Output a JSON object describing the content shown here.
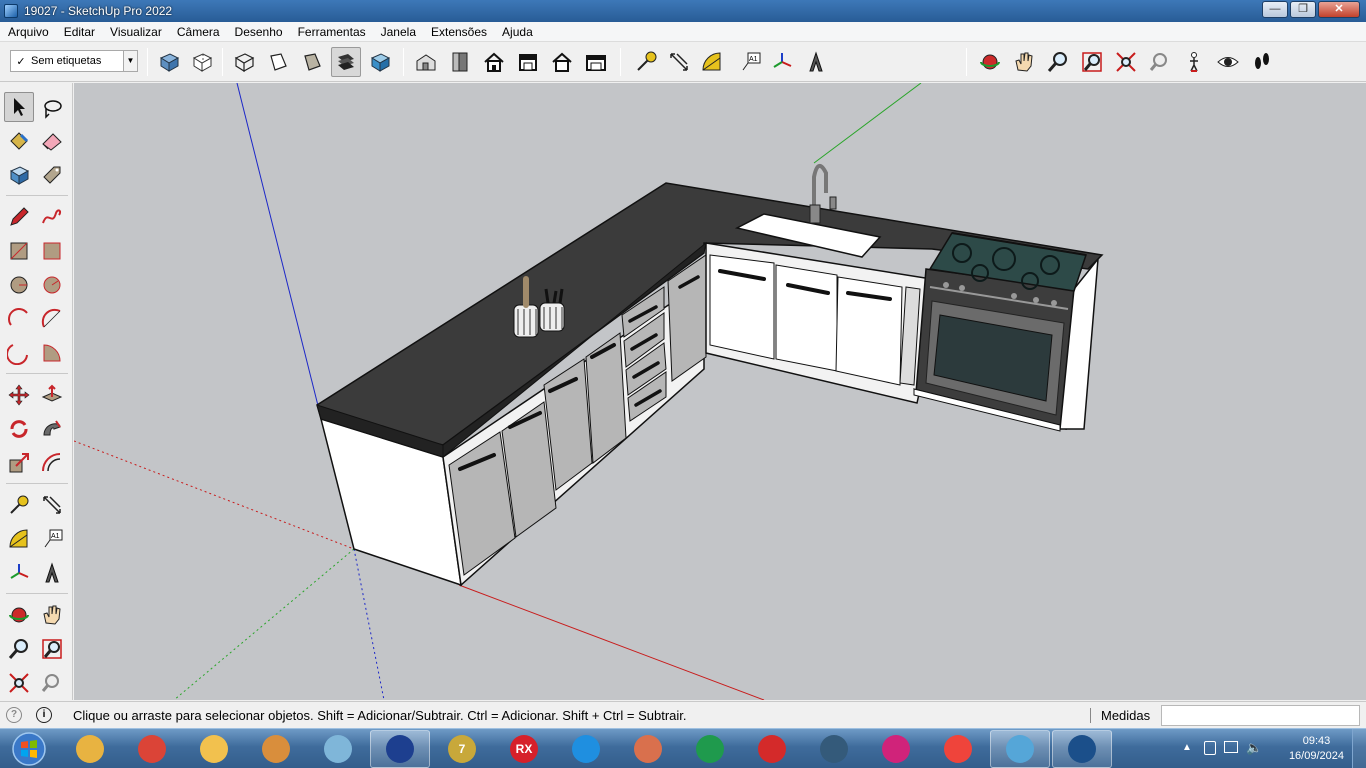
{
  "window": {
    "title": "19027 - SketchUp Pro 2022",
    "buttons": {
      "minimize": "—",
      "maximize": "❐",
      "close": "✕"
    }
  },
  "menu": [
    "Arquivo",
    "Editar",
    "Visualizar",
    "Câmera",
    "Desenho",
    "Ferramentas",
    "Janela",
    "Extensões",
    "Ajuda"
  ],
  "toolbar": {
    "tag_selector": {
      "value": "Sem etiquetas",
      "checked": true
    },
    "style_icons": [
      "xray-style-icon",
      "back-edges-style-icon",
      "wireframe-style-icon",
      "hidden-line-style-icon",
      "shaded-style-icon",
      "shaded-textures-style-icon",
      "monochrome-style-icon"
    ],
    "active_style": "shaded-textures-style-icon",
    "view_icons": [
      "iso-view-icon",
      "top-view-icon",
      "front-view-icon",
      "right-view-icon",
      "back-view-icon",
      "left-view-icon"
    ],
    "construction_icons": [
      "tape-measure-icon",
      "dimension-icon",
      "protractor-icon",
      "text-icon",
      "axes-icon",
      "3d-text-icon"
    ],
    "camera_icons": [
      "orbit-icon",
      "pan-icon",
      "zoom-icon",
      "zoom-window-icon",
      "zoom-extents-icon",
      "previous-view-icon",
      "position-camera-icon",
      "look-around-icon",
      "walk-icon"
    ]
  },
  "palette": {
    "active_tool": "select-tool-icon",
    "tools": [
      "select-tool-icon",
      "lasso-select-icon",
      "paint-bucket-icon",
      "eraser-icon",
      "make-component-icon",
      "tag-tool-icon",
      "pencil-icon",
      "freehand-icon",
      "rectangle-icon",
      "rotated-rectangle-icon",
      "circle-icon",
      "polygon-icon",
      "arc-icon",
      "two-point-arc-icon",
      "three-point-arc-icon",
      "pie-icon",
      "move-icon",
      "push-pull-icon",
      "rotate-icon",
      "follow-me-icon",
      "scale-icon",
      "offset-icon",
      "tape-measure-icon",
      "dimension-icon",
      "protractor-icon",
      "text-icon",
      "axes-icon",
      "3d-text-icon",
      "orbit-icon",
      "pan-icon",
      "zoom-icon",
      "zoom-window-icon",
      "zoom-extents-icon",
      "previous-view-icon"
    ]
  },
  "status": {
    "hint": "Clique ou arraste para selecionar objetos. Shift = Adicionar/Subtrair. Ctrl = Adicionar. Shift + Ctrl = Subtrair.",
    "measure_label": "Medidas",
    "measure_value": ""
  },
  "taskbar": {
    "apps": [
      {
        "name": "file-explorer-icon",
        "color": "#e8b341",
        "label": ""
      },
      {
        "name": "chrome-icon",
        "color": "#db4437",
        "label": ""
      },
      {
        "name": "photo-viewer-icon",
        "color": "#f2c14e",
        "label": ""
      },
      {
        "name": "paint-icon",
        "color": "#d98e3c",
        "label": ""
      },
      {
        "name": "notes-icon",
        "color": "#7fb6d9",
        "label": ""
      },
      {
        "name": "app-blue-icon",
        "color": "#1d3f8f",
        "label": ""
      },
      {
        "name": "7zip-icon",
        "color": "#c8a83a",
        "label": "7"
      },
      {
        "name": "rx-icon",
        "color": "#d6202a",
        "label": "RX"
      },
      {
        "name": "app-p-blue-icon",
        "color": "#1f8fe0",
        "label": ""
      },
      {
        "name": "app-p-orange-icon",
        "color": "#d9704d",
        "label": ""
      },
      {
        "name": "app-p-green-icon",
        "color": "#1f9a4d",
        "label": ""
      },
      {
        "name": "app-p-red-icon",
        "color": "#d42a2a",
        "label": ""
      },
      {
        "name": "app-p-dark-icon",
        "color": "#345a7a",
        "label": ""
      },
      {
        "name": "app-p-magenta-icon",
        "color": "#d0237a",
        "label": ""
      },
      {
        "name": "anydesk-icon",
        "color": "#ef443b",
        "label": ""
      },
      {
        "name": "rocket-icon",
        "color": "#55a6d8",
        "label": ""
      },
      {
        "name": "sketchup-icon",
        "color": "#1b4f8a",
        "label": ""
      }
    ],
    "clock_time": "09:43",
    "clock_date": "16/09/2024"
  }
}
